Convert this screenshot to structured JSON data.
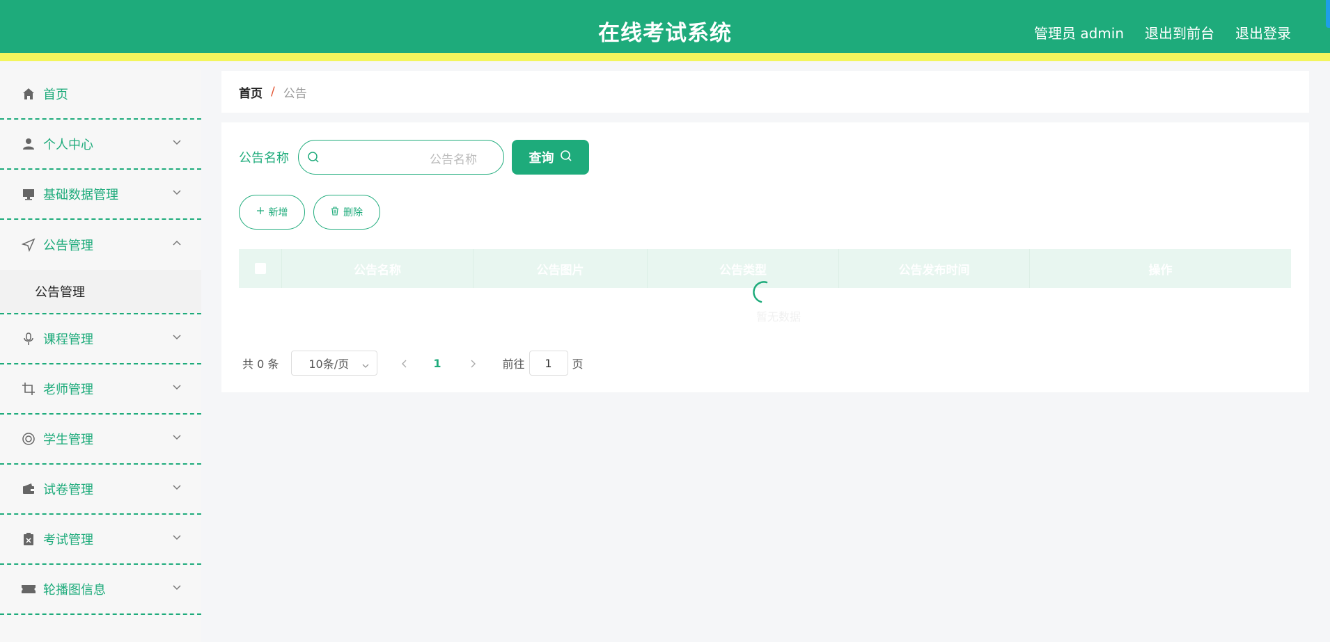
{
  "header": {
    "title": "在线考试系统",
    "admin": "管理员 admin",
    "exit_front": "退出到前台",
    "logout": "退出登录"
  },
  "sidebar": {
    "items": [
      {
        "label": "首页",
        "icon": "home-icon"
      },
      {
        "label": "个人中心",
        "icon": "user-icon"
      },
      {
        "label": "基础数据管理",
        "icon": "monitor-icon"
      },
      {
        "label": "公告管理",
        "icon": "send-icon",
        "expanded": true,
        "children": [
          "公告管理"
        ]
      },
      {
        "label": "课程管理",
        "icon": "microphone-icon"
      },
      {
        "label": "老师管理",
        "icon": "crop-icon"
      },
      {
        "label": "学生管理",
        "icon": "lifebuoy-icon"
      },
      {
        "label": "试卷管理",
        "icon": "wallet-icon"
      },
      {
        "label": "考试管理",
        "icon": "clipboard-x-icon"
      },
      {
        "label": "轮播图信息",
        "icon": "ticket-icon"
      }
    ]
  },
  "breadcrumb": {
    "home": "首页",
    "separator": "/",
    "current": "公告"
  },
  "search": {
    "label": "公告名称",
    "placeholder": "公告名称",
    "query_button": "查询"
  },
  "actions": {
    "add": "新增",
    "delete": "删除"
  },
  "table": {
    "columns": [
      "公告名称",
      "公告图片",
      "公告类型",
      "公告发布时间",
      "操作"
    ],
    "empty_text": "暂无数据"
  },
  "pagination": {
    "total": "共 0 条",
    "page_size": "10条/页",
    "current_page": "1",
    "goto_label": "前往",
    "goto_value": "1",
    "page_suffix": "页"
  },
  "colors": {
    "primary": "#1eab7b",
    "accent_strip": "#f3f55d",
    "breadcrumb_separator": "#e2502d"
  }
}
